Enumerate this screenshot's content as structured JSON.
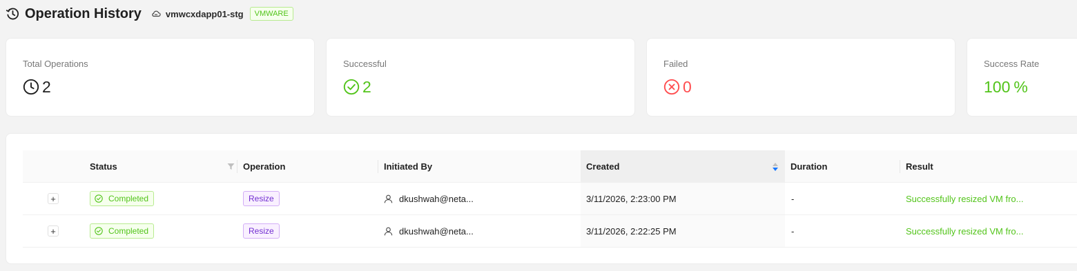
{
  "header": {
    "title": "Operation History",
    "host": "vmwcxdapp01-stg",
    "platform_tag": "VMWARE"
  },
  "stats": {
    "total": {
      "label": "Total Operations",
      "value": "2"
    },
    "successful": {
      "label": "Successful",
      "value": "2"
    },
    "failed": {
      "label": "Failed",
      "value": "0"
    },
    "success_rate": {
      "label": "Success Rate",
      "value": "100",
      "unit": "%"
    }
  },
  "table": {
    "columns": {
      "status": "Status",
      "operation": "Operation",
      "initiated_by": "Initiated By",
      "created": "Created",
      "duration": "Duration",
      "result": "Result"
    },
    "rows": [
      {
        "expand": "+",
        "status": "Completed",
        "operation": "Resize",
        "initiated_by": "dkushwah@neta...",
        "created": "3/11/2026, 2:23:00 PM",
        "duration": "-",
        "result": "Successfully resized VM fro..."
      },
      {
        "expand": "+",
        "status": "Completed",
        "operation": "Resize",
        "initiated_by": "dkushwah@neta...",
        "created": "3/11/2026, 2:22:25 PM",
        "duration": "-",
        "result": "Successfully resized VM fro..."
      }
    ]
  },
  "colors": {
    "success": "#52c41a",
    "failed": "#ff4d4f",
    "operation_tag": "#722ed1",
    "sort_active": "#1677ff"
  },
  "icons": {
    "title": "history-icon",
    "host": "cloud-icon",
    "total": "clock-icon",
    "successful": "check-circle-icon",
    "failed": "close-circle-icon",
    "status_filter": "filter-icon",
    "created_sort": "sort-icon",
    "status_badge": "check-circle-icon",
    "initiator": "user-icon"
  }
}
